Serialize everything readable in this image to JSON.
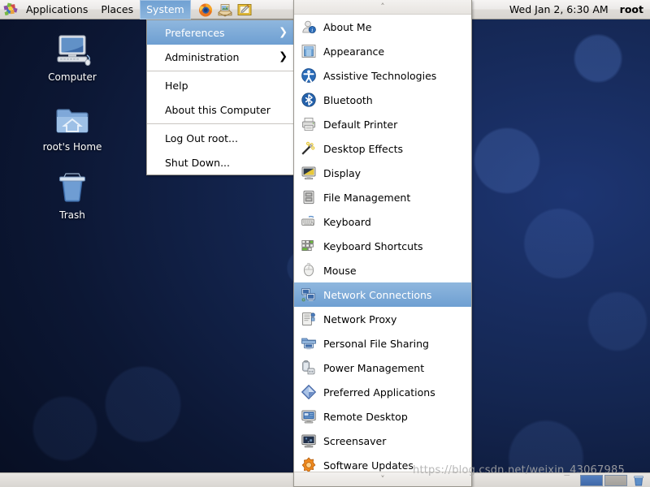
{
  "panel": {
    "foot_icon": "gnome-foot-icon",
    "menus": [
      {
        "label": "Applications",
        "active": false,
        "name": "menubar-applications"
      },
      {
        "label": "Places",
        "active": false,
        "name": "menubar-places"
      },
      {
        "label": "System",
        "active": true,
        "name": "menubar-system"
      }
    ],
    "launchers": [
      {
        "name": "firefox-launcher-icon",
        "title": "Firefox Web Browser"
      },
      {
        "name": "evolution-mail-launcher-icon",
        "title": "Evolution Mail"
      },
      {
        "name": "text-editor-launcher-icon",
        "title": "Text Editor"
      }
    ],
    "clock": "Wed Jan  2,  6:30 AM",
    "user": "root"
  },
  "desktop": {
    "icons": [
      {
        "label": "Computer",
        "icon": "computer-icon",
        "name": "desktop-icon-computer"
      },
      {
        "label": "root's Home",
        "icon": "home-folder-icon",
        "name": "desktop-icon-home"
      },
      {
        "label": "Trash",
        "icon": "trash-icon",
        "name": "desktop-icon-trash"
      }
    ]
  },
  "system_menu": {
    "items": [
      {
        "label": "Preferences",
        "selected": true,
        "submenu": true,
        "arrow": "❯",
        "name": "system-menu-item-preferences"
      },
      {
        "label": "Administration",
        "selected": false,
        "submenu": true,
        "arrow": "❯",
        "name": "system-menu-item-administration"
      },
      {
        "separator": true
      },
      {
        "label": "Help",
        "selected": false,
        "submenu": false,
        "name": "system-menu-item-help"
      },
      {
        "label": "About this Computer",
        "selected": false,
        "submenu": false,
        "name": "system-menu-item-about-this-computer"
      },
      {
        "separator": true
      },
      {
        "label": "Log Out root...",
        "selected": false,
        "submenu": false,
        "name": "system-menu-item-log-out"
      },
      {
        "label": "Shut Down...",
        "selected": false,
        "submenu": false,
        "name": "system-menu-item-shut-down"
      }
    ]
  },
  "preferences_menu": {
    "scroll_up": "˄",
    "scroll_down": "˅",
    "items": [
      {
        "label": "About Me",
        "icon": "about-me-icon",
        "selected": false
      },
      {
        "label": "Appearance",
        "icon": "appearance-icon",
        "selected": false
      },
      {
        "label": "Assistive Technologies",
        "icon": "assistive-technologies-icon",
        "selected": false
      },
      {
        "label": "Bluetooth",
        "icon": "bluetooth-icon",
        "selected": false
      },
      {
        "label": "Default Printer",
        "icon": "printer-icon",
        "selected": false
      },
      {
        "label": "Desktop Effects",
        "icon": "desktop-effects-icon",
        "selected": false
      },
      {
        "label": "Display",
        "icon": "display-icon",
        "selected": false
      },
      {
        "label": "File Management",
        "icon": "file-management-icon",
        "selected": false
      },
      {
        "label": "Keyboard",
        "icon": "keyboard-icon",
        "selected": false
      },
      {
        "label": "Keyboard Shortcuts",
        "icon": "keyboard-shortcuts-icon",
        "selected": false
      },
      {
        "label": "Mouse",
        "icon": "mouse-icon",
        "selected": false
      },
      {
        "label": "Network Connections",
        "icon": "network-connections-icon",
        "selected": true
      },
      {
        "label": "Network Proxy",
        "icon": "network-proxy-icon",
        "selected": false
      },
      {
        "label": "Personal File Sharing",
        "icon": "personal-file-sharing-icon",
        "selected": false
      },
      {
        "label": "Power Management",
        "icon": "power-management-icon",
        "selected": false
      },
      {
        "label": "Preferred Applications",
        "icon": "preferred-applications-icon",
        "selected": false
      },
      {
        "label": "Remote Desktop",
        "icon": "remote-desktop-icon",
        "selected": false
      },
      {
        "label": "Screensaver",
        "icon": "screensaver-icon",
        "selected": false
      },
      {
        "label": "Software Updates",
        "icon": "software-updates-icon",
        "selected": false
      }
    ]
  },
  "bottom_panel": {
    "workspaces": [
      {
        "active": true
      },
      {
        "active": false
      }
    ],
    "trash_icon": "trash-applet-icon"
  },
  "watermark": {
    "text": "https://blog.csdn.net/weixin_43067985"
  },
  "colors": {
    "selection_top": "#8fb7de",
    "selection_bottom": "#6e9fd2",
    "panel_bg": "#ece9e6",
    "desktop_blue": "#1d3572"
  }
}
